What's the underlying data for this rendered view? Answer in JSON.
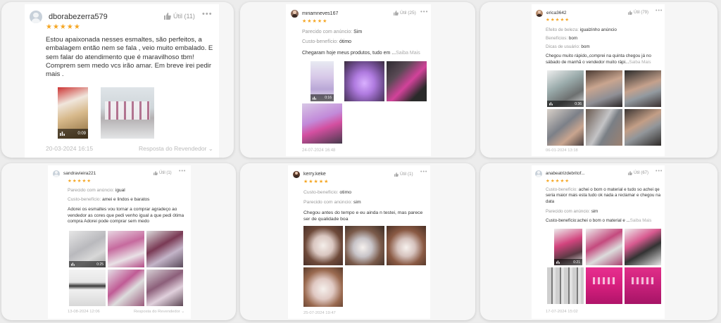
{
  "reviews": [
    {
      "user": "dborabezerra579",
      "util": "Útil (11)",
      "stars": "★★★★★",
      "text": "Estou apaixonada nesses esmaltes, são perfeitos, a embalagem então nem se fala , veio muito embalado. E sem falar do atendimento que é maravilhoso tbm! Comprem sem medo vcs irão amar. Em breve irei pedir mais .",
      "video_duration": "0:09",
      "date": "20-03-2024 16:15",
      "reply": "Resposta do Revendedor"
    },
    {
      "user": "miriamneves167",
      "util": "Útil (25)",
      "stars": "★★★★★",
      "attr1_label": "Parecido com anúncio:",
      "attr1_value": "Sim",
      "attr2_label": "Custo-benefício:",
      "attr2_value": "ótimo",
      "text": "Chegaram hoje meus produtos, tudo em ...",
      "more": "Saiba Mais",
      "video_duration": "0:16",
      "date": "24-07-2024 16:48"
    },
    {
      "user": "erica3642",
      "util": "Útil (79)",
      "stars": "★★★★★",
      "attr1_label": "Efeito de beleza:",
      "attr1_value": "igualzinho anúncio",
      "attr2_label": "Benefícios:",
      "attr2_value": "bom",
      "attr3_label": "Dicas de usuário:",
      "attr3_value": "bom",
      "text": "Chegou muito rápido,,comprei na quinta chegou já no sábado de manhã o vendedor muito rápi...",
      "more": "Saiba Mais",
      "video_duration": "0:36",
      "date": "06-01-2024 13:18"
    },
    {
      "user": "sandravieira221",
      "util": "Útil (1)",
      "stars": "★★★★★",
      "attr1_label": "Parecido com anúncio:",
      "attr1_value": "igual",
      "attr2_label": "Custo-benefício:",
      "attr2_value": "amei e lindos e baratos",
      "text": "Adorei os esmaltes vou tornar a comprar agradeço ao vendedor as cores que pedi venho igual a que pedi ótima compra Adorei pode comprar sem medo",
      "video_duration": "0:25",
      "date": "13-08-2024 12:06",
      "reply": "Resposta do Revendedor"
    },
    {
      "user": "kerry.keke",
      "util": "Útil (1)",
      "stars": "★★★★★",
      "attr1_label": "Custo-benefício:",
      "attr1_value": "otimo",
      "attr2_label": "Parecido com anúncio:",
      "attr2_value": "sim",
      "text": "Chegou antes do tempo e eu ainda n testei, mas parece ser de qualidade boa",
      "date": "25-07-2024 19:47"
    },
    {
      "user": "anabeatrizdebritof...",
      "util": "Útil (67)",
      "stars": "★★★★★",
      "attr1_label": "Custo-benefício:",
      "attr1_value": "achei o bom o material e tudo so achei qe seria maior mais esta tudo ok nada a reclamar e chegou na data",
      "attr2_label": "Parecido com anúncio:",
      "attr2_value": "sim",
      "text": "Custo-benefício:achei o bom o material e ...",
      "more": "Saiba Mais",
      "video_duration": "0:21",
      "date": "17-07-2024 15:02"
    }
  ],
  "icons": {
    "helpful": "thumbs-up-icon",
    "menu": "more-dots-icon",
    "avatar": "avatar-icon",
    "play": "video-bars-icon",
    "chevron": "chevron-down-icon"
  },
  "colors": {
    "star": "#f5a623",
    "muted": "#999999",
    "panel": "#f6f6f6"
  }
}
